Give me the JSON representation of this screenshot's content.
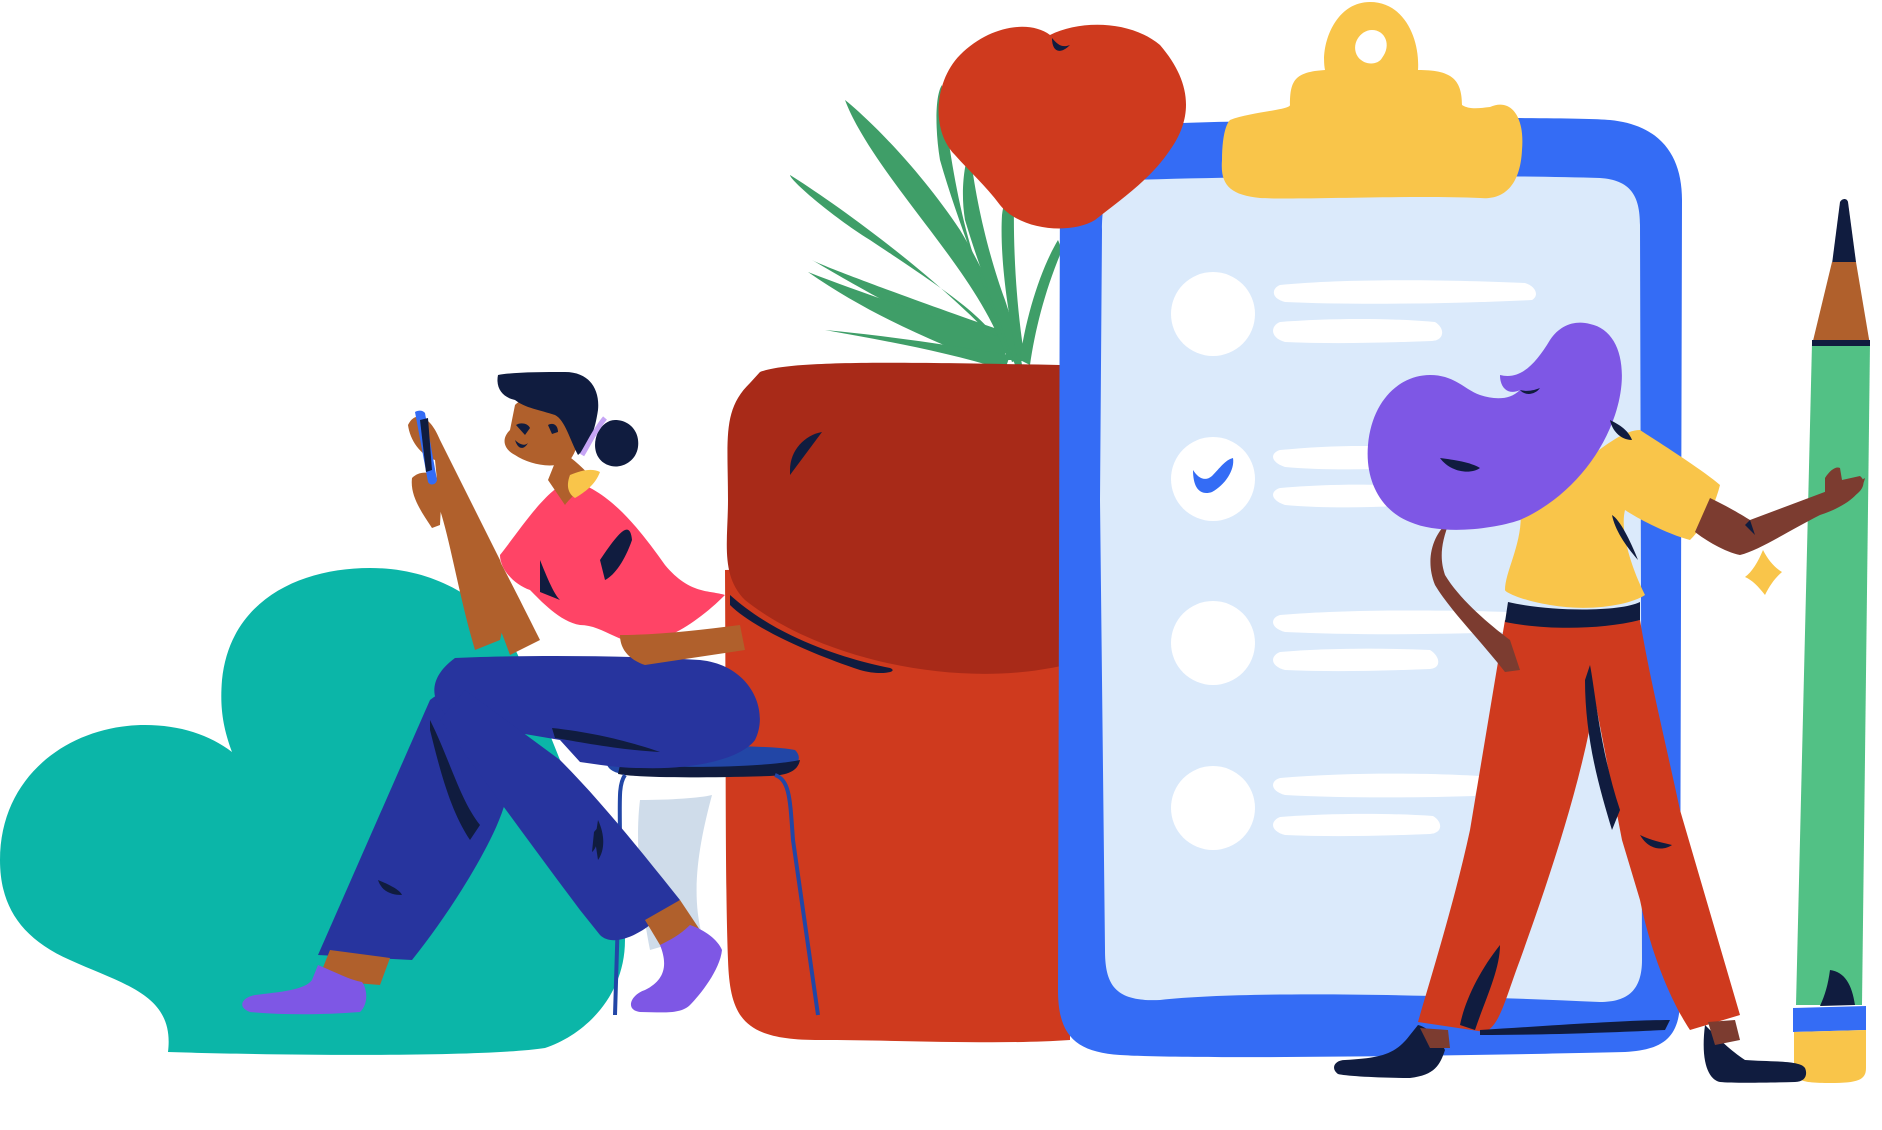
{
  "illustration": {
    "subject": "checklist-with-heart-and-people",
    "colors": {
      "background": "#ffffff",
      "bush": "#0bb6a8",
      "pot_dark": "#a82a18",
      "pot": "#cf3a1e",
      "leaf": "#3f9e68",
      "heart": "#cf3a1e",
      "clipboard_frame": "#346cf5",
      "clipboard_paper": "#dbeafb",
      "clip": "#f9c54a",
      "list_bullet": "#ffffff",
      "checkmark": "#346cf5",
      "pencil_body": "#52c185",
      "pencil_wood": "#b0602c",
      "pencil_band": "#346cf5",
      "pencil_eraser": "#f9c54a",
      "navy": "#101c3f",
      "left_shirt": "#ff4466",
      "left_pants": "#27349e",
      "left_shoes": "#7e57e5",
      "stool": "#2246a6",
      "right_hair": "#7e57e5",
      "right_shirt": "#f9c54a",
      "right_pants": "#cf3a1e",
      "skin_left": "#b0602c",
      "skin_right": "#7c3c30"
    },
    "checklist": {
      "item_count": 4,
      "checked_items": [
        2
      ]
    }
  }
}
